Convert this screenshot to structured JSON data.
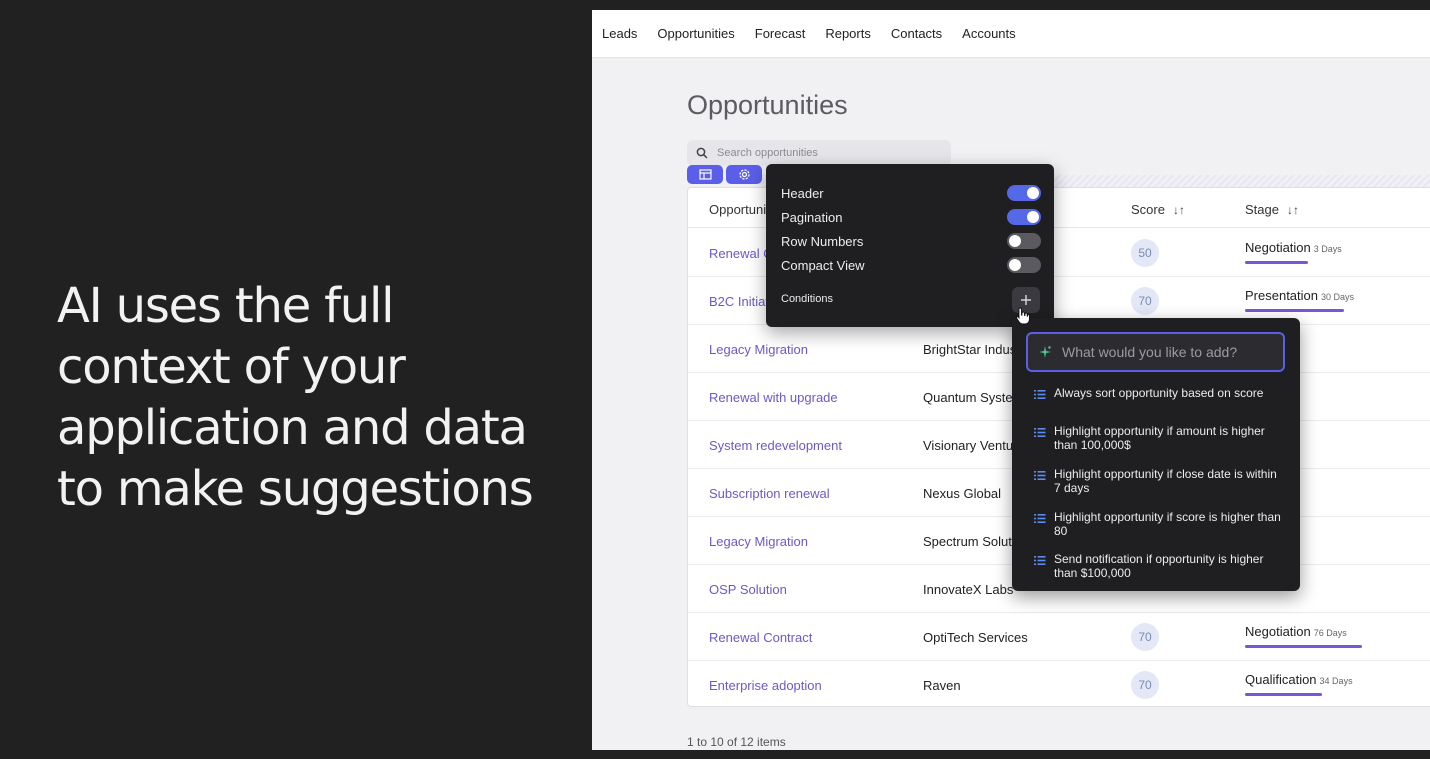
{
  "hero": {
    "text": "AI uses the full context of your application and data to make suggestions"
  },
  "nav": {
    "items": [
      "Leads",
      "Opportunities",
      "Forecast",
      "Reports",
      "Contacts",
      "Accounts"
    ]
  },
  "page": {
    "title": "Opportunities",
    "search_placeholder": "Search opportunities",
    "pager": "1 to 10 of 12 items"
  },
  "table": {
    "headers": {
      "opportunity": "Opportunit",
      "score": "Score",
      "stage": "Stage"
    },
    "rows": [
      {
        "opportunity": "Renewal C",
        "account": "",
        "score": "50",
        "stage": "Negotiation",
        "days": "3 Days",
        "stage_progress": 0.35
      },
      {
        "opportunity": "B2C Initiat",
        "account": "",
        "score": "70",
        "stage": "Presentation",
        "days": "30 Days",
        "stage_progress": 0.55
      },
      {
        "opportunity": "Legacy Migration",
        "account": "BrightStar Indus",
        "score": "",
        "stage": "",
        "days": "",
        "stage_progress": 0.0
      },
      {
        "opportunity": "Renewal with upgrade",
        "account": "Quantum Syste",
        "score": "",
        "stage": "",
        "days": "",
        "stage_progress": 0.0
      },
      {
        "opportunity": "System redevelopment",
        "account": "Visionary Ventu",
        "score": "",
        "stage": "",
        "days": "",
        "stage_progress": 0.0
      },
      {
        "opportunity": "Subscription renewal",
        "account": "Nexus Global",
        "score": "",
        "stage": "",
        "days": "",
        "stage_progress": 0.0
      },
      {
        "opportunity": "Legacy Migration",
        "account": "Spectrum Soluti",
        "score": "",
        "stage": "",
        "days": "",
        "stage_progress": 0.0
      },
      {
        "opportunity": "OSP Solution",
        "account": "InnovateX Labs",
        "score": "",
        "stage": "",
        "days": "",
        "stage_progress": 0.0
      },
      {
        "opportunity": "Renewal Contract",
        "account": "OptiTech Services",
        "score": "70",
        "stage": "Negotiation",
        "days": "76 Days",
        "stage_progress": 0.65
      },
      {
        "opportunity": "Enterprise adoption",
        "account": "Raven",
        "score": "70",
        "stage": "Qualification",
        "days": "34 Days",
        "stage_progress": 0.43
      }
    ]
  },
  "settings": {
    "items": [
      {
        "label": "Header",
        "on": true
      },
      {
        "label": "Pagination",
        "on": true
      },
      {
        "label": "Row Numbers",
        "on": false
      },
      {
        "label": "Compact View",
        "on": false
      }
    ],
    "conditions_label": "Conditions"
  },
  "ai": {
    "placeholder": "What would you like to add?",
    "suggestions": [
      "Always sort opportunity based on score",
      "Highlight opportunity if amount is higher than 100,000$",
      "Highlight opportunity if close date is within 7 days",
      "Highlight opportunity if score is higher than 80",
      "Send notification if opportunity is higher than $100,000"
    ]
  },
  "colors": {
    "accent": "#5a5ee8",
    "link": "#6e58c8",
    "dark_panel": "#1f1f22",
    "stage_bar": "#7a55d6"
  }
}
